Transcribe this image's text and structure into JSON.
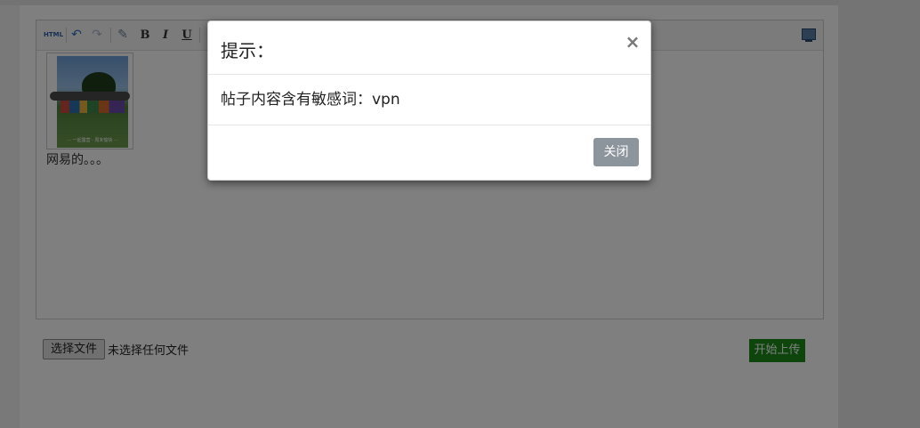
{
  "editor": {
    "toolbar": {
      "html_label": "HTML",
      "undo_icon": "↶",
      "redo_icon": "↷",
      "eraser_icon": "✎",
      "bold_label": "B",
      "italic_label": "I",
      "underline_label": "U"
    },
    "image_caption": "··· 一起露营 · 周末愉快 ···",
    "body_text": "网易的。。。"
  },
  "uploader": {
    "choose_file_label": "选择文件",
    "file_status": "未选择任何文件",
    "start_upload_label": "开始上传"
  },
  "modal": {
    "title": "提示：",
    "close_icon": "×",
    "message": "帖子内容含有敏感词：vpn",
    "close_button_label": "关闭"
  },
  "colors": {
    "upload_button": "#1a8a1a",
    "close_button": "#8c949c",
    "backdrop": "rgba(0,0,0,0.5)"
  }
}
